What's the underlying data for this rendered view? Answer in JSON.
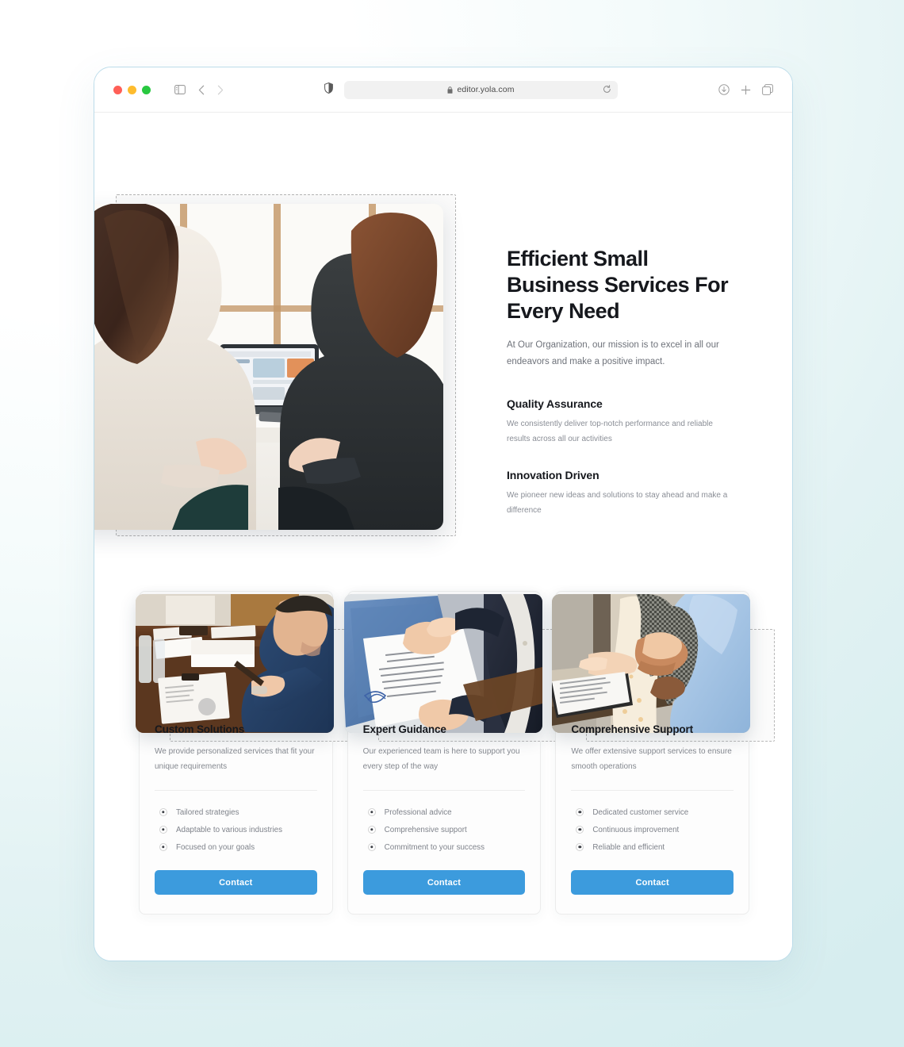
{
  "browser": {
    "url": "editor.yola.com",
    "traffic_lights": [
      "close",
      "minimize",
      "zoom"
    ],
    "icons": {
      "sidebar": "sidebar-icon",
      "back": "chevron-left-icon",
      "forward": "chevron-right-icon",
      "shield": "shield-icon",
      "lock": "lock-icon",
      "reload": "reload-icon",
      "download": "download-icon",
      "new_tab": "plus-icon",
      "tabs_overview": "tabs-icon"
    }
  },
  "hero": {
    "title": "Efficient Small Business Services For Every Need",
    "subtitle": "At Our Organization, our mission is to excel in all our endeavors and make a positive impact.",
    "image_alt": "two-women-at-laptop-photo",
    "features": [
      {
        "title": "Quality Assurance",
        "description": "We consistently deliver top-notch performance and reliable results across all our activities"
      },
      {
        "title": "Innovation Driven",
        "description": "We pioneer new ideas and solutions to stay ahead and make a difference"
      }
    ]
  },
  "cards": [
    {
      "title": "Custom Solutions",
      "description": "We provide personalized services that fit your unique requirements",
      "image_alt": "man-writing-at-desk-photo",
      "bullets": [
        "Tailored strategies",
        "Adaptable to various industries",
        "Focused on your goals"
      ],
      "button_label": "Contact"
    },
    {
      "title": "Expert Guidance",
      "description": "Our experienced team is here to support you every step of the way",
      "image_alt": "signed-document-in-blue-folder-photo",
      "bullets": [
        "Professional advice",
        "Comprehensive support",
        "Commitment to your success"
      ],
      "button_label": "Contact"
    },
    {
      "title": "Comprehensive Support",
      "description": "We offer extensive support services to ensure smooth operations",
      "image_alt": "two-people-handshake-outdoors-photo",
      "bullets": [
        "Dedicated customer service",
        "Continuous improvement",
        "Reliable and efficient"
      ],
      "button_label": "Contact"
    }
  ],
  "colors": {
    "accent": "#3c9bdd",
    "heading": "#16181d",
    "body_text": "#84888f",
    "page_background": "#ffffff",
    "canvas_background": "#d6edef",
    "traffic_red": "#ff5f57",
    "traffic_yellow": "#febc2e",
    "traffic_green": "#28c840"
  }
}
